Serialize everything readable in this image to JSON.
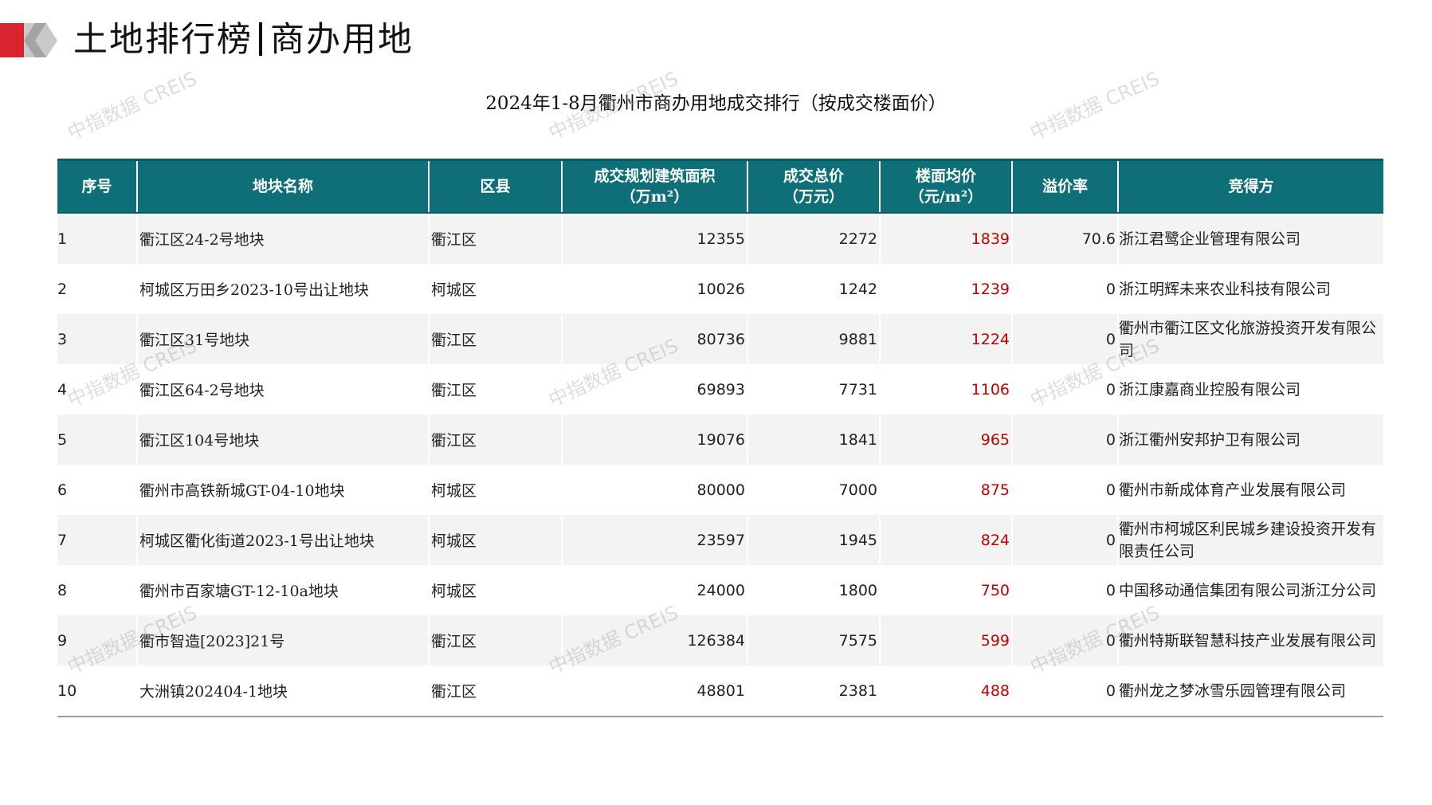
{
  "header": {
    "title_left": "土地排行榜",
    "title_right": "商办用地"
  },
  "table_title": "2024年1-8月衢州市商办用地成交排行（按成交楼面价）",
  "watermark": "中指数据 CREIS",
  "columns": [
    {
      "line1": "序号",
      "line2": ""
    },
    {
      "line1": "地块名称",
      "line2": ""
    },
    {
      "line1": "区县",
      "line2": ""
    },
    {
      "line1": "成交规划建筑面积",
      "line2": "（万m²）"
    },
    {
      "line1": "成交总价",
      "line2": "（万元）"
    },
    {
      "line1": "楼面均价",
      "line2": "（元/m²）"
    },
    {
      "line1": "溢价率",
      "line2": ""
    },
    {
      "line1": "竞得方",
      "line2": ""
    }
  ],
  "rows": [
    {
      "rank": "1",
      "name": "衢江区24-2号地块",
      "district": "衢江区",
      "area": "12355",
      "total": "2272",
      "price": "1839",
      "premium": "70.6",
      "winner": "浙江君鹭企业管理有限公司"
    },
    {
      "rank": "2",
      "name": "柯城区万田乡2023-10号出让地块",
      "district": "柯城区",
      "area": "10026",
      "total": "1242",
      "price": "1239",
      "premium": "0",
      "winner": "浙江明辉未来农业科技有限公司"
    },
    {
      "rank": "3",
      "name": "衢江区31号地块",
      "district": "衢江区",
      "area": "80736",
      "total": "9881",
      "price": "1224",
      "premium": "0",
      "winner": "衢州市衢江区文化旅游投资开发有限公司"
    },
    {
      "rank": "4",
      "name": "衢江区64-2号地块",
      "district": "衢江区",
      "area": "69893",
      "total": "7731",
      "price": "1106",
      "premium": "0",
      "winner": "浙江康嘉商业控股有限公司"
    },
    {
      "rank": "5",
      "name": "衢江区104号地块",
      "district": "衢江区",
      "area": "19076",
      "total": "1841",
      "price": "965",
      "premium": "0",
      "winner": "浙江衢州安邦护卫有限公司"
    },
    {
      "rank": "6",
      "name": "衢州市高铁新城GT-04-10地块",
      "district": "柯城区",
      "area": "80000",
      "total": "7000",
      "price": "875",
      "premium": "0",
      "winner": "衢州市新成体育产业发展有限公司"
    },
    {
      "rank": "7",
      "name": "柯城区衢化街道2023-1号出让地块",
      "district": "柯城区",
      "area": "23597",
      "total": "1945",
      "price": "824",
      "premium": "0",
      "winner": "衢州市柯城区利民城乡建设投资开发有限责任公司"
    },
    {
      "rank": "8",
      "name": "衢州市百家塘GT-12-10a地块",
      "district": "柯城区",
      "area": "24000",
      "total": "1800",
      "price": "750",
      "premium": "0",
      "winner": "中国移动通信集团有限公司浙江分公司"
    },
    {
      "rank": "9",
      "name": "衢市智造[2023]21号",
      "district": "衢江区",
      "area": "126384",
      "total": "7575",
      "price": "599",
      "premium": "0",
      "winner": "衢州特斯联智慧科技产业发展有限公司"
    },
    {
      "rank": "10",
      "name": "大洲镇202404-1地块",
      "district": "衢江区",
      "area": "48801",
      "total": "2381",
      "price": "488",
      "premium": "0",
      "winner": "衢州龙之梦冰雪乐园管理有限公司"
    }
  ],
  "colors": {
    "header_bg": "#0e6f78",
    "price_text": "#c00000",
    "accent_red": "#d9232e"
  }
}
